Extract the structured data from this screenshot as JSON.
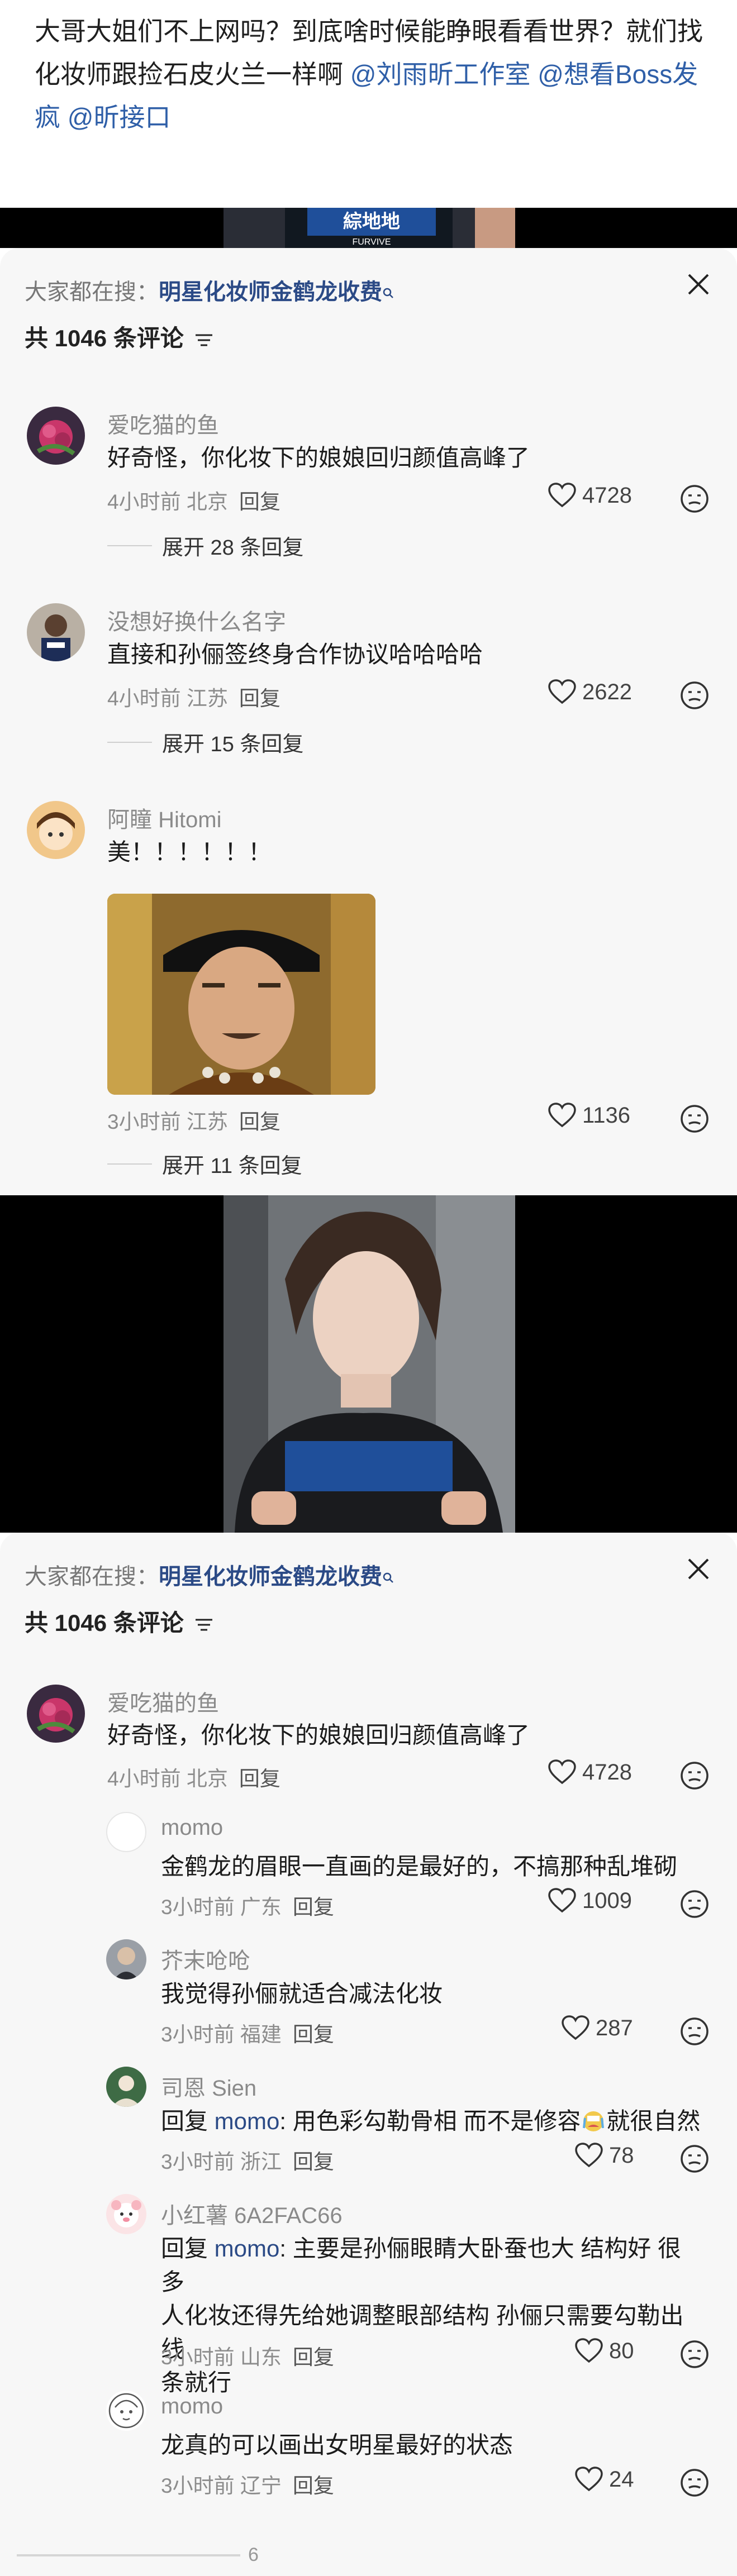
{
  "post": {
    "text": "大哥大姐们不上网吗？到底啥时候能睁眼看看世界？就们找化妆师跟捡石皮火兰一样啊 ",
    "mentions": [
      "@刘雨昕工作室",
      "@想看Boss发疯",
      "@昕接口"
    ]
  },
  "video_top": {
    "overlay_text": "FURVIVE"
  },
  "video_mid": {
    "overlay_text": ""
  },
  "panel1": {
    "search_prefix": "大家都在搜：",
    "search_term": "明星化妆师金鹤龙收费",
    "count_label": "共 1046 条评论",
    "comments": [
      {
        "username": "爱吃猫的鱼",
        "text": "好奇怪，你化妆下的娘娘回归颜值高峰了",
        "time": "4小时前",
        "location": "北京",
        "reply_label": "回复",
        "likes": "4728",
        "expand_label": "展开 28 条回复"
      },
      {
        "username": "没想好换什么名字",
        "text": "直接和孙俪签终身合作协议哈哈哈哈",
        "time": "4小时前",
        "location": "江苏",
        "reply_label": "回复",
        "likes": "2622",
        "expand_label": "展开 15 条回复"
      },
      {
        "username": "阿瞳 Hitomi",
        "text": "美！！！！！！",
        "time": "3小时前",
        "location": "江苏",
        "reply_label": "回复",
        "likes": "1136",
        "expand_label": "展开 11 条回复"
      }
    ]
  },
  "panel2": {
    "search_prefix": "大家都在搜：",
    "search_term": "明星化妆师金鹤龙收费",
    "count_label": "共 1046 条评论",
    "main": {
      "username": "爱吃猫的鱼",
      "text": "好奇怪，你化妆下的娘娘回归颜值高峰了",
      "time": "4小时前",
      "location": "北京",
      "reply_label": "回复",
      "likes": "4728"
    },
    "replies": [
      {
        "username": "momo",
        "text": "金鹤龙的眉眼一直画的是最好的，不搞那种乱堆砌",
        "time": "3小时前",
        "location": "广东",
        "reply_label": "回复",
        "likes": "1009"
      },
      {
        "username": "芥末呛呛",
        "text": "我觉得孙俪就适合减法化妆",
        "time": "3小时前",
        "location": "福建",
        "reply_label": "回复",
        "likes": "287"
      },
      {
        "username": "司恩 Sien",
        "reply_prefix": "回复 ",
        "reply_to": "momo",
        "text": ": 用色彩勾勒骨相 而不是修容",
        "text_after": "就很自然",
        "time": "3小时前",
        "location": "浙江",
        "reply_label": "回复",
        "likes": "78"
      },
      {
        "username": "小红薯 6A2FAC66",
        "reply_prefix": "回复 ",
        "reply_to": "momo",
        "text_line1": ": 主要是孙俪眼睛大卧蚕也大 结构好 很多",
        "text_line2": "人化妆还得先给她调整眼部结构 孙俪只需要勾勒出线",
        "text_line3": "条就行",
        "time": "3小时前",
        "location": "山东",
        "reply_label": "回复",
        "likes": "80"
      },
      {
        "username": "momo",
        "text": "龙真的可以画出女明星最好的状态",
        "time": "3小时前",
        "location": "辽宁",
        "reply_label": "回复",
        "likes": "24"
      }
    ]
  },
  "footer": {
    "page": "6"
  },
  "colors": {
    "link": "#2f5fa8",
    "meta": "#8c8c8c",
    "panel_bg": "#f7f7f7"
  }
}
